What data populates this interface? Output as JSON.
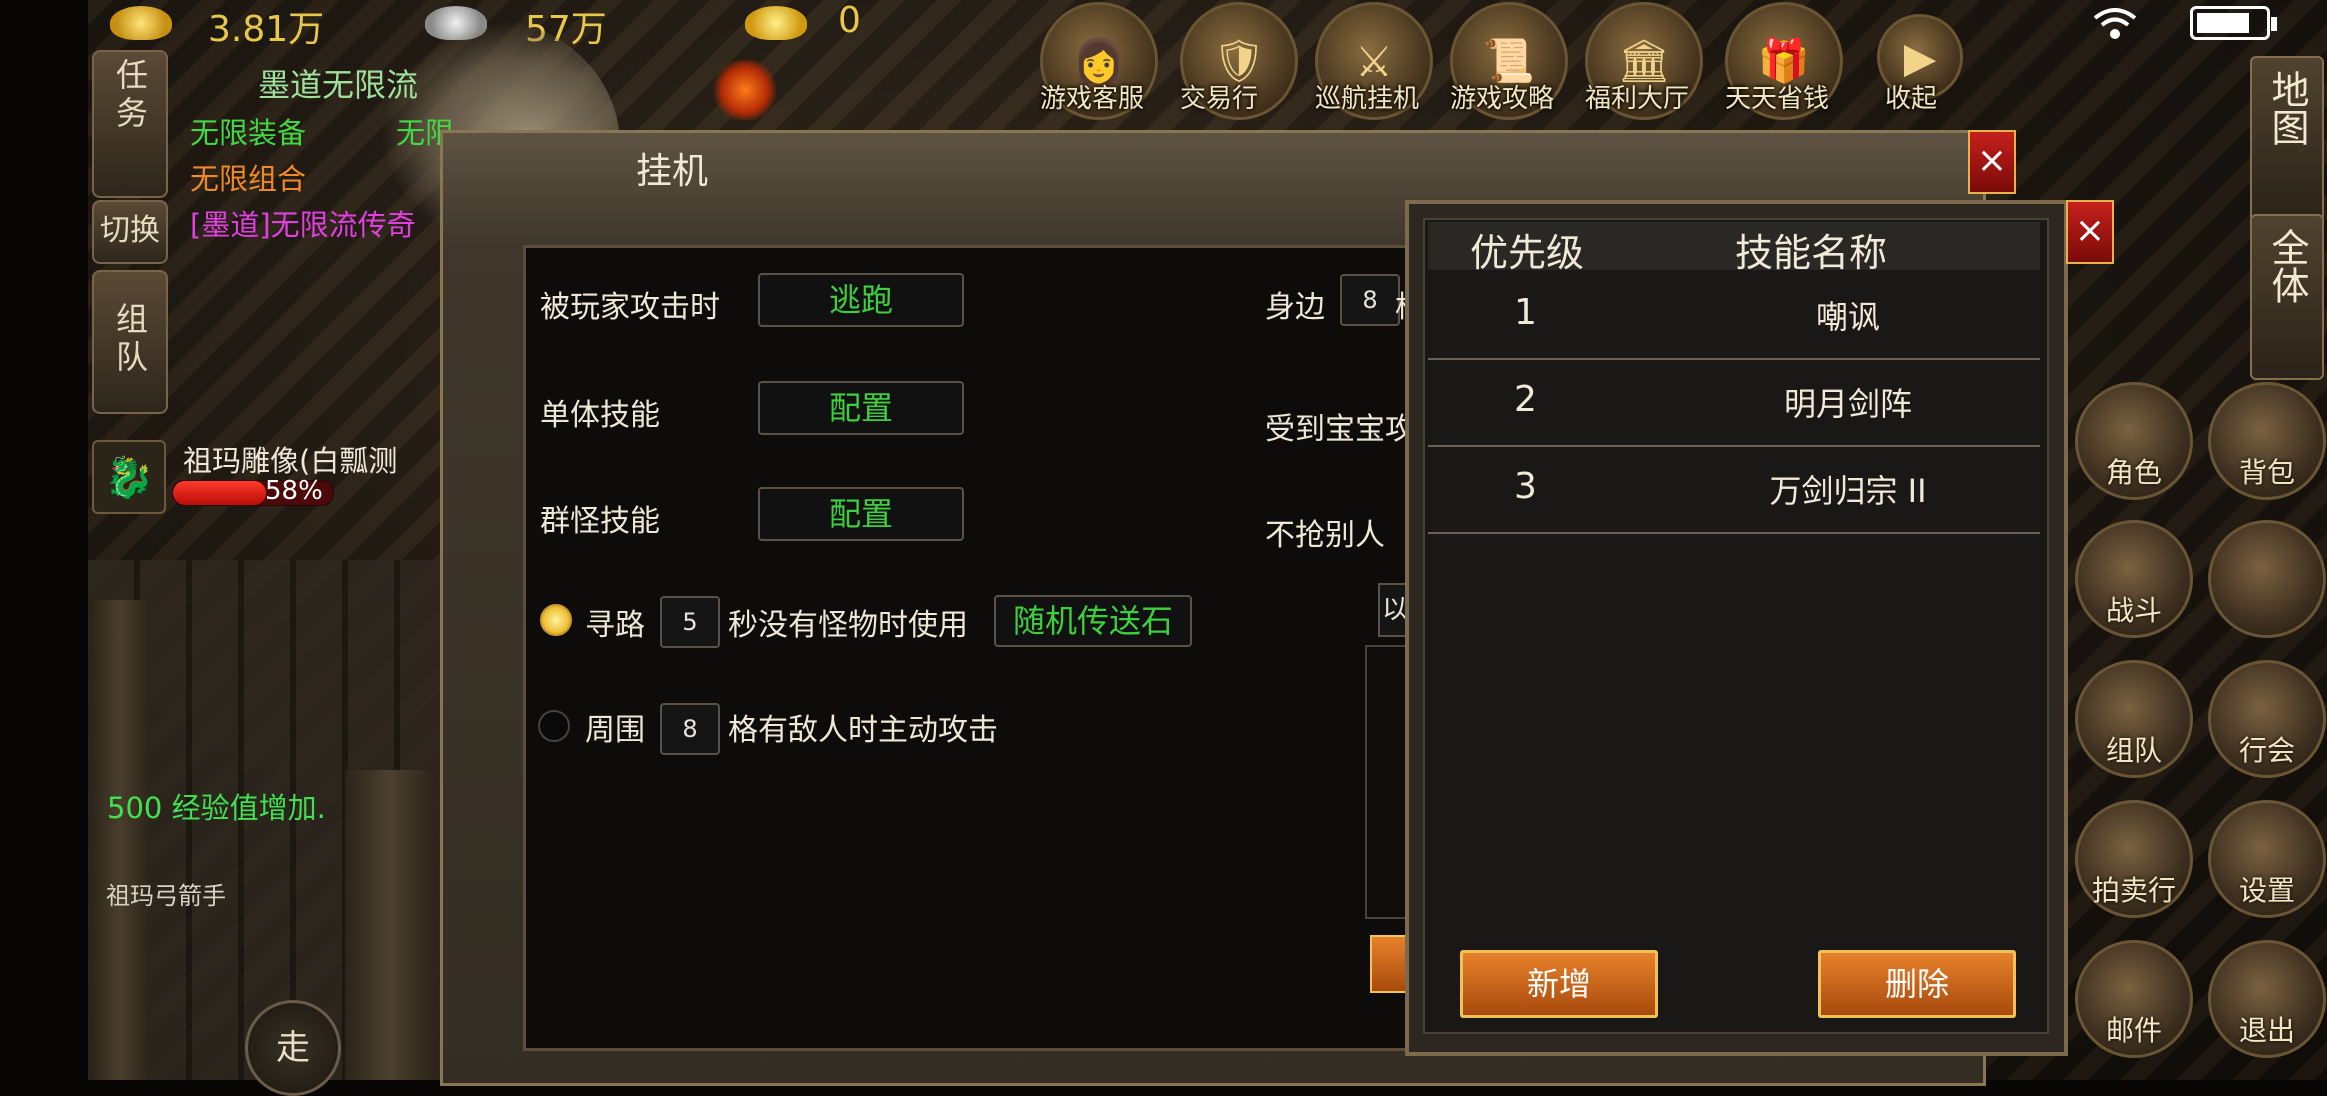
{
  "resources": {
    "gold": "3.81万",
    "silver": "57万",
    "ingot": "0"
  },
  "top_menu": [
    {
      "label": "游戏客服",
      "icon": "customer-service-icon"
    },
    {
      "label": "交易行",
      "icon": "trade-icon"
    },
    {
      "label": "巡航挂机",
      "icon": "auto-cruise-icon"
    },
    {
      "label": "游戏攻略",
      "icon": "guide-icon"
    },
    {
      "label": "福利大厅",
      "icon": "welfare-icon"
    },
    {
      "label": "天天省钱",
      "icon": "gift-box-icon"
    },
    {
      "label": "收起",
      "icon": "collapse-arrow-icon"
    }
  ],
  "left_tabs": {
    "task": "任务",
    "switch": "切换",
    "team": "组队"
  },
  "quests": {
    "title": "墨道无限流",
    "line1_a": "无限装备",
    "line1_b": "无限",
    "line2_a": "无限组合",
    "line3": "[墨道]无限流传奇"
  },
  "target": {
    "name": "祖玛雕像(白瓢测",
    "hp_percent": "58%",
    "hp_value": 58
  },
  "chat": {
    "exp_msg": "500 经验值增加.",
    "npc": "祖玛弓箭手"
  },
  "walk_label": "走",
  "right_tabs": {
    "map": "地图",
    "all": "全体"
  },
  "right_buttons": [
    {
      "label": "角色",
      "icon": "character-icon"
    },
    {
      "label": "背包",
      "icon": "bag-icon"
    },
    {
      "label": "战斗",
      "icon": "battle-swords-icon"
    },
    {
      "label": "",
      "icon": "move-arrows-icon"
    },
    {
      "label": "组队",
      "icon": "team-icon"
    },
    {
      "label": "行会",
      "icon": "guild-icon"
    },
    {
      "label": "拍卖行",
      "icon": "auction-hammer-icon"
    },
    {
      "label": "设置",
      "icon": "settings-gear-icon"
    },
    {
      "label": "邮件",
      "icon": "mail-icon"
    },
    {
      "label": "退出",
      "icon": "exit-arrow-icon"
    }
  ],
  "dialog": {
    "title": "挂机",
    "attacked_by_player_label": "被玩家攻击时",
    "attacked_by_player_value": "逃跑",
    "single_skill_label": "单体技能",
    "single_skill_value": "配置",
    "group_skill_label": "群怪技能",
    "group_skill_value": "配置",
    "pathfind_label": "寻路",
    "pathfind_seconds": "5",
    "pathfind_suffix": "秒没有怪物时使用",
    "pathfind_item": "随机传送石",
    "around_label": "周围",
    "around_cells": "8",
    "around_suffix": "格有敌人时主动攻击",
    "side_label": "身边",
    "side_value": "8",
    "side_suffix": "格",
    "pet_attacked_label": "受到宝宝攻",
    "no_steal_label": "不抢别人",
    "partial_text": "以"
  },
  "skill_popup": {
    "header_priority": "优先级",
    "header_skill": "技能名称",
    "rows": [
      {
        "priority": "1",
        "skill": "嘲讽"
      },
      {
        "priority": "2",
        "skill": "明月剑阵"
      },
      {
        "priority": "3",
        "skill": "万剑归宗 II"
      }
    ],
    "add_button": "新增",
    "delete_button": "删除"
  },
  "close_glyph": "×"
}
